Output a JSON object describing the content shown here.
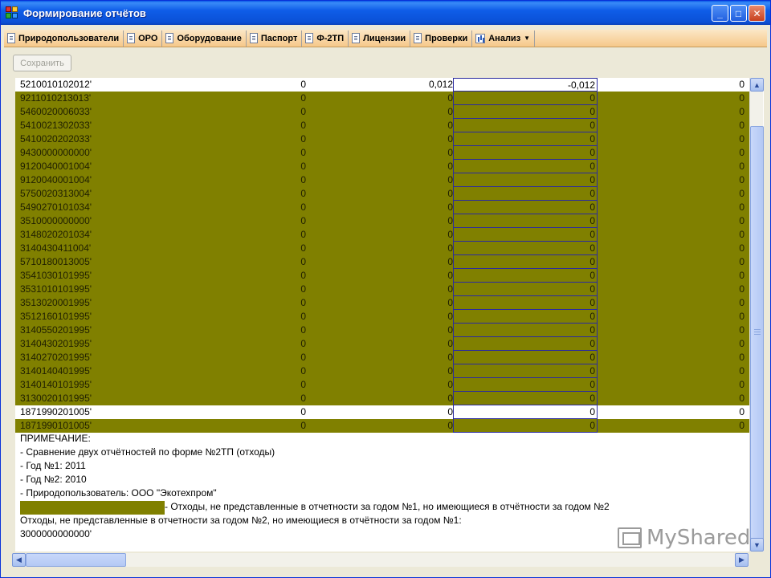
{
  "window": {
    "title": "Формирование отчётов",
    "buttons": {
      "minimize": "_",
      "maximize": "□",
      "close": "✕"
    }
  },
  "menu": {
    "items": [
      {
        "label": "Природопользователи",
        "icon": "document-icon"
      },
      {
        "label": "ОРО",
        "icon": "document-icon"
      },
      {
        "label": "Оборудование",
        "icon": "document-icon"
      },
      {
        "label": "Паспорт",
        "icon": "document-icon"
      },
      {
        "label": "Ф-2ТП",
        "icon": "document-icon"
      },
      {
        "label": "Лицензии",
        "icon": "document-icon"
      },
      {
        "label": "Проверки",
        "icon": "document-icon"
      },
      {
        "label": "Анализ",
        "icon": "chart-icon",
        "dropdown": "▼"
      }
    ]
  },
  "toolbar": {
    "save_label": "Сохранить"
  },
  "grid": {
    "rows": [
      {
        "code": "5210010102012'",
        "v1": "0",
        "v2": "0,012",
        "v3": "-0,012",
        "v4": "0",
        "style": "white"
      },
      {
        "code": "9211010213013'",
        "v1": "0",
        "v2": "0",
        "v3": "0",
        "v4": "0",
        "style": "olive"
      },
      {
        "code": "5460020006033'",
        "v1": "0",
        "v2": "0",
        "v3": "0",
        "v4": "0",
        "style": "olive"
      },
      {
        "code": "5410021302033'",
        "v1": "0",
        "v2": "0",
        "v3": "0",
        "v4": "0",
        "style": "olive"
      },
      {
        "code": "5410020202033'",
        "v1": "0",
        "v2": "0",
        "v3": "0",
        "v4": "0",
        "style": "olive"
      },
      {
        "code": "9430000000000'",
        "v1": "0",
        "v2": "0",
        "v3": "0",
        "v4": "0",
        "style": "olive"
      },
      {
        "code": "9120040001004'",
        "v1": "0",
        "v2": "0",
        "v3": "0",
        "v4": "0",
        "style": "olive"
      },
      {
        "code": "9120040001004'",
        "v1": "0",
        "v2": "0",
        "v3": "0",
        "v4": "0",
        "style": "olive"
      },
      {
        "code": "5750020313004'",
        "v1": "0",
        "v2": "0",
        "v3": "0",
        "v4": "0",
        "style": "olive"
      },
      {
        "code": "5490270101034'",
        "v1": "0",
        "v2": "0",
        "v3": "0",
        "v4": "0",
        "style": "olive"
      },
      {
        "code": "3510000000000'",
        "v1": "0",
        "v2": "0",
        "v3": "0",
        "v4": "0",
        "style": "olive"
      },
      {
        "code": "3148020201034'",
        "v1": "0",
        "v2": "0",
        "v3": "0",
        "v4": "0",
        "style": "olive"
      },
      {
        "code": "3140430411004'",
        "v1": "0",
        "v2": "0",
        "v3": "0",
        "v4": "0",
        "style": "olive"
      },
      {
        "code": "5710180013005'",
        "v1": "0",
        "v2": "0",
        "v3": "0",
        "v4": "0",
        "style": "olive"
      },
      {
        "code": "3541030101995'",
        "v1": "0",
        "v2": "0",
        "v3": "0",
        "v4": "0",
        "style": "olive"
      },
      {
        "code": "3531010101995'",
        "v1": "0",
        "v2": "0",
        "v3": "0",
        "v4": "0",
        "style": "olive"
      },
      {
        "code": "3513020001995'",
        "v1": "0",
        "v2": "0",
        "v3": "0",
        "v4": "0",
        "style": "olive"
      },
      {
        "code": "3512160101995'",
        "v1": "0",
        "v2": "0",
        "v3": "0",
        "v4": "0",
        "style": "olive"
      },
      {
        "code": "3140550201995'",
        "v1": "0",
        "v2": "0",
        "v3": "0",
        "v4": "0",
        "style": "olive"
      },
      {
        "code": "3140430201995'",
        "v1": "0",
        "v2": "0",
        "v3": "0",
        "v4": "0",
        "style": "olive"
      },
      {
        "code": "3140270201995'",
        "v1": "0",
        "v2": "0",
        "v3": "0",
        "v4": "0",
        "style": "olive"
      },
      {
        "code": "3140140401995'",
        "v1": "0",
        "v2": "0",
        "v3": "0",
        "v4": "0",
        "style": "olive"
      },
      {
        "code": "3140140101995'",
        "v1": "0",
        "v2": "0",
        "v3": "0",
        "v4": "0",
        "style": "olive"
      },
      {
        "code": "3130020101995'",
        "v1": "0",
        "v2": "0",
        "v3": "0",
        "v4": "0",
        "style": "olive"
      },
      {
        "code": "1871990201005'",
        "v1": "0",
        "v2": "0",
        "v3": "0",
        "v4": "0",
        "style": "white"
      },
      {
        "code": "1871990101005'",
        "v1": "0",
        "v2": "0",
        "v3": "0",
        "v4": "0",
        "style": "olive"
      }
    ]
  },
  "notes": {
    "heading": "ПРИМЕЧАНИЕ:",
    "line1": " - Сравнение двух отчётностей по форме №2ТП (отходы)",
    "line2": " - Год №1: 2011",
    "line3": " - Год №2: 2010",
    "line4": " - Природопользователь: ООО \"Экотехпром\"",
    "legend_text": " - Отходы, не представленные в отчетности за годом №1, но имеющиеся в отчётности за годом №2",
    "line6": "Отходы, не представленные в отчетности за годом №2, но имеющиеся в отчётности за годом №1:",
    "line7": "3000000000000'"
  },
  "watermark": {
    "text": "MyShared"
  },
  "colors": {
    "highlight": "#808000",
    "selection_border": "#2a2aa0",
    "titlebar": "#0a50d6"
  }
}
